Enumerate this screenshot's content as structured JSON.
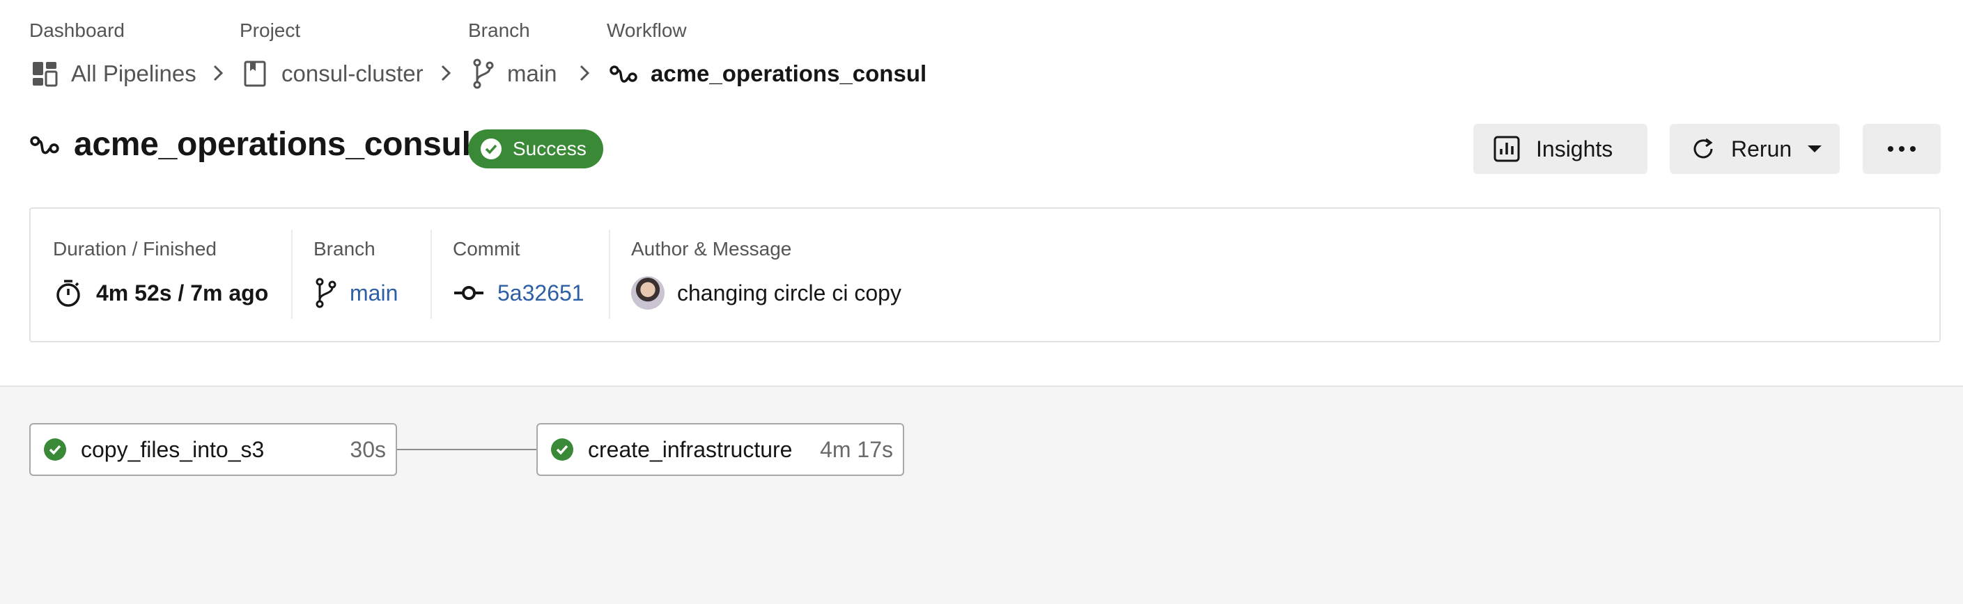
{
  "breadcrumbs": [
    {
      "label": "Dashboard",
      "value": "All Pipelines",
      "icon": "dashboard-icon"
    },
    {
      "label": "Project",
      "value": "consul-cluster",
      "icon": "project-book-icon"
    },
    {
      "label": "Branch",
      "value": "main",
      "icon": "branch-icon"
    },
    {
      "label": "Workflow",
      "value": "acme_operations_consul",
      "icon": "workflow-icon"
    }
  ],
  "header": {
    "title": "acme_operations_consul",
    "status": "Success",
    "status_color": "#398937"
  },
  "actions": {
    "insights": "Insights",
    "rerun": "Rerun",
    "more_icon": "more-horizontal-icon"
  },
  "summary": {
    "duration_label": "Duration / Finished",
    "duration_value": "4m 52s / 7m ago",
    "branch_label": "Branch",
    "branch_value": "main",
    "commit_label": "Commit",
    "commit_value": "5a32651",
    "author_label": "Author & Message",
    "message": "changing circle ci copy"
  },
  "jobs": [
    {
      "name": "copy_files_into_s3",
      "duration": "30s",
      "status": "success"
    },
    {
      "name": "create_infrastructure",
      "duration": "4m 17s",
      "status": "success"
    }
  ],
  "colors": {
    "accent_link": "#2d5fa6",
    "success": "#398937",
    "canvas_bg": "#f5f5f5"
  }
}
